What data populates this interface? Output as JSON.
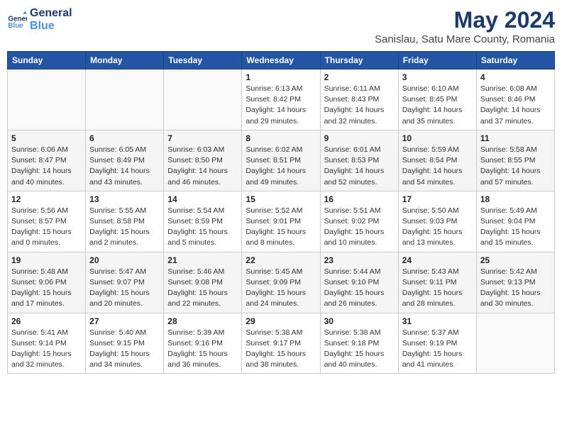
{
  "header": {
    "logo_line1": "General",
    "logo_line2": "Blue",
    "month_year": "May 2024",
    "location": "Sanislau, Satu Mare County, Romania"
  },
  "weekdays": [
    "Sunday",
    "Monday",
    "Tuesday",
    "Wednesday",
    "Thursday",
    "Friday",
    "Saturday"
  ],
  "weeks": [
    [
      {
        "day": "",
        "info": ""
      },
      {
        "day": "",
        "info": ""
      },
      {
        "day": "",
        "info": ""
      },
      {
        "day": "1",
        "info": "Sunrise: 6:13 AM\nSunset: 8:42 PM\nDaylight: 14 hours\nand 29 minutes."
      },
      {
        "day": "2",
        "info": "Sunrise: 6:11 AM\nSunset: 8:43 PM\nDaylight: 14 hours\nand 32 minutes."
      },
      {
        "day": "3",
        "info": "Sunrise: 6:10 AM\nSunset: 8:45 PM\nDaylight: 14 hours\nand 35 minutes."
      },
      {
        "day": "4",
        "info": "Sunrise: 6:08 AM\nSunset: 8:46 PM\nDaylight: 14 hours\nand 37 minutes."
      }
    ],
    [
      {
        "day": "5",
        "info": "Sunrise: 6:06 AM\nSunset: 8:47 PM\nDaylight: 14 hours\nand 40 minutes."
      },
      {
        "day": "6",
        "info": "Sunrise: 6:05 AM\nSunset: 8:49 PM\nDaylight: 14 hours\nand 43 minutes."
      },
      {
        "day": "7",
        "info": "Sunrise: 6:03 AM\nSunset: 8:50 PM\nDaylight: 14 hours\nand 46 minutes."
      },
      {
        "day": "8",
        "info": "Sunrise: 6:02 AM\nSunset: 8:51 PM\nDaylight: 14 hours\nand 49 minutes."
      },
      {
        "day": "9",
        "info": "Sunrise: 6:01 AM\nSunset: 8:53 PM\nDaylight: 14 hours\nand 52 minutes."
      },
      {
        "day": "10",
        "info": "Sunrise: 5:59 AM\nSunset: 8:54 PM\nDaylight: 14 hours\nand 54 minutes."
      },
      {
        "day": "11",
        "info": "Sunrise: 5:58 AM\nSunset: 8:55 PM\nDaylight: 14 hours\nand 57 minutes."
      }
    ],
    [
      {
        "day": "12",
        "info": "Sunrise: 5:56 AM\nSunset: 8:57 PM\nDaylight: 15 hours\nand 0 minutes."
      },
      {
        "day": "13",
        "info": "Sunrise: 5:55 AM\nSunset: 8:58 PM\nDaylight: 15 hours\nand 2 minutes."
      },
      {
        "day": "14",
        "info": "Sunrise: 5:54 AM\nSunset: 8:59 PM\nDaylight: 15 hours\nand 5 minutes."
      },
      {
        "day": "15",
        "info": "Sunrise: 5:52 AM\nSunset: 9:01 PM\nDaylight: 15 hours\nand 8 minutes."
      },
      {
        "day": "16",
        "info": "Sunrise: 5:51 AM\nSunset: 9:02 PM\nDaylight: 15 hours\nand 10 minutes."
      },
      {
        "day": "17",
        "info": "Sunrise: 5:50 AM\nSunset: 9:03 PM\nDaylight: 15 hours\nand 13 minutes."
      },
      {
        "day": "18",
        "info": "Sunrise: 5:49 AM\nSunset: 9:04 PM\nDaylight: 15 hours\nand 15 minutes."
      }
    ],
    [
      {
        "day": "19",
        "info": "Sunrise: 5:48 AM\nSunset: 9:06 PM\nDaylight: 15 hours\nand 17 minutes."
      },
      {
        "day": "20",
        "info": "Sunrise: 5:47 AM\nSunset: 9:07 PM\nDaylight: 15 hours\nand 20 minutes."
      },
      {
        "day": "21",
        "info": "Sunrise: 5:46 AM\nSunset: 9:08 PM\nDaylight: 15 hours\nand 22 minutes."
      },
      {
        "day": "22",
        "info": "Sunrise: 5:45 AM\nSunset: 9:09 PM\nDaylight: 15 hours\nand 24 minutes."
      },
      {
        "day": "23",
        "info": "Sunrise: 5:44 AM\nSunset: 9:10 PM\nDaylight: 15 hours\nand 26 minutes."
      },
      {
        "day": "24",
        "info": "Sunrise: 5:43 AM\nSunset: 9:11 PM\nDaylight: 15 hours\nand 28 minutes."
      },
      {
        "day": "25",
        "info": "Sunrise: 5:42 AM\nSunset: 9:13 PM\nDaylight: 15 hours\nand 30 minutes."
      }
    ],
    [
      {
        "day": "26",
        "info": "Sunrise: 5:41 AM\nSunset: 9:14 PM\nDaylight: 15 hours\nand 32 minutes."
      },
      {
        "day": "27",
        "info": "Sunrise: 5:40 AM\nSunset: 9:15 PM\nDaylight: 15 hours\nand 34 minutes."
      },
      {
        "day": "28",
        "info": "Sunrise: 5:39 AM\nSunset: 9:16 PM\nDaylight: 15 hours\nand 36 minutes."
      },
      {
        "day": "29",
        "info": "Sunrise: 5:38 AM\nSunset: 9:17 PM\nDaylight: 15 hours\nand 38 minutes."
      },
      {
        "day": "30",
        "info": "Sunrise: 5:38 AM\nSunset: 9:18 PM\nDaylight: 15 hours\nand 40 minutes."
      },
      {
        "day": "31",
        "info": "Sunrise: 5:37 AM\nSunset: 9:19 PM\nDaylight: 15 hours\nand 41 minutes."
      },
      {
        "day": "",
        "info": ""
      }
    ]
  ]
}
